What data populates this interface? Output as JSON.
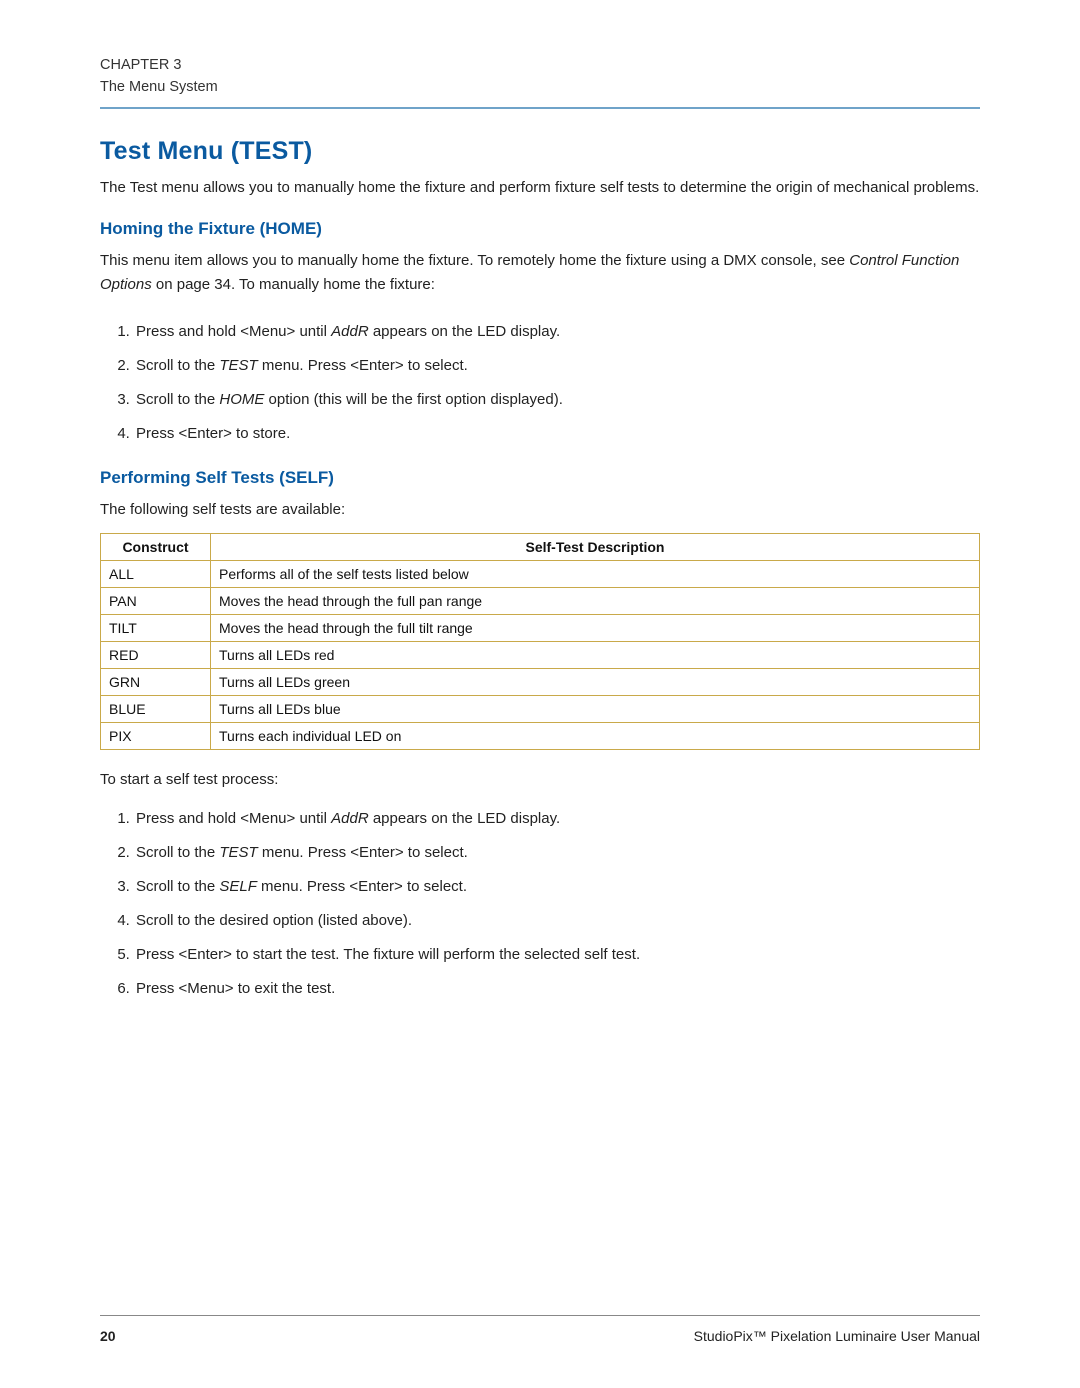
{
  "header": {
    "chapter": "CHAPTER 3",
    "section": "The Menu System"
  },
  "h1": "Test Menu (TEST)",
  "intro": "The Test menu allows you to manually home the fixture and perform fixture self tests to determine the origin of mechanical problems.",
  "homing": {
    "title": "Homing the Fixture (HOME)",
    "para_pre": "This menu item allows you to manually home the fixture. To remotely home the fixture using a DMX console, see ",
    "ref": "Control Function Options",
    "para_post": " on page 34. To manually home the fixture:",
    "steps": [
      {
        "pre": "Press and hold <Menu> until ",
        "em": "AddR",
        "post": " appears on the LED display."
      },
      {
        "pre": "Scroll to the ",
        "em": "TEST",
        "post": " menu. Press <Enter> to select."
      },
      {
        "pre": "Scroll to the ",
        "em": "HOME",
        "post": " option (this will be the first option displayed)."
      },
      {
        "pre": "Press <Enter> to store.",
        "em": "",
        "post": ""
      }
    ]
  },
  "self": {
    "title": "Performing Self Tests (SELF)",
    "lead": "The following self tests are available:",
    "table": {
      "head": [
        "Construct",
        "Self-Test Description"
      ],
      "rows": [
        [
          "ALL",
          "Performs all of the self tests listed below"
        ],
        [
          "PAN",
          "Moves the head through the full pan range"
        ],
        [
          "TILT",
          "Moves the head through the full tilt range"
        ],
        [
          "RED",
          "Turns all LEDs red"
        ],
        [
          "GRN",
          "Turns all LEDs green"
        ],
        [
          "BLUE",
          "Turns all LEDs blue"
        ],
        [
          "PIX",
          "Turns each individual LED on"
        ]
      ]
    },
    "lead2": "To start a self test process:",
    "steps": [
      {
        "pre": "Press and hold <Menu> until ",
        "em": "AddR",
        "post": " appears on the LED display."
      },
      {
        "pre": "Scroll to the ",
        "em": "TEST",
        "post": " menu. Press <Enter> to select."
      },
      {
        "pre": "Scroll to the ",
        "em": "SELF",
        "post": " menu. Press <Enter> to select."
      },
      {
        "pre": "Scroll to the desired option (listed above).",
        "em": "",
        "post": ""
      },
      {
        "pre": "Press <Enter> to start the test. The fixture will perform the selected self test.",
        "em": "",
        "post": ""
      },
      {
        "pre": "Press <Menu> to exit the test.",
        "em": "",
        "post": ""
      }
    ]
  },
  "footer": {
    "page": "20",
    "doc": "StudioPix™ Pixelation Luminaire User Manual"
  }
}
